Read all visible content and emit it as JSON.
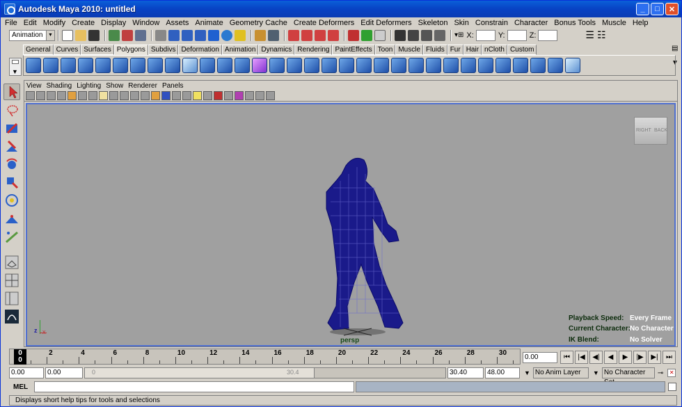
{
  "window": {
    "title": "Autodesk Maya 2010: untitled"
  },
  "menus": [
    "File",
    "Edit",
    "Modify",
    "Create",
    "Display",
    "Window",
    "Assets",
    "Animate",
    "Geometry Cache",
    "Create Deformers",
    "Edit Deformers",
    "Skeleton",
    "Skin",
    "Constrain",
    "Character",
    "Bonus Tools",
    "Muscle",
    "Help"
  ],
  "status": {
    "menuset": "Animation",
    "x_label": "X:",
    "y_label": "Y:",
    "z_label": "Z:"
  },
  "shelf": {
    "tabs": [
      "General",
      "Curves",
      "Surfaces",
      "Polygons",
      "Subdivs",
      "Deformation",
      "Animation",
      "Dynamics",
      "Rendering",
      "PaintEffects",
      "Toon",
      "Muscle",
      "Fluids",
      "Fur",
      "Hair",
      "nCloth",
      "Custom"
    ],
    "active_tab": "Polygons"
  },
  "viewport": {
    "menus": [
      "View",
      "Shading",
      "Lighting",
      "Show",
      "Renderer",
      "Panels"
    ],
    "camera": "persp",
    "viewcube_right": "RIGHT",
    "viewcube_back": "BACK",
    "axis_z": "z",
    "axis_x": "x",
    "hud": [
      {
        "label": "Playback Speed:",
        "value": "Every Frame"
      },
      {
        "label": "Current Character:",
        "value": "No Character"
      },
      {
        "label": "IK Blend:",
        "value": "No Solver"
      }
    ]
  },
  "timeline": {
    "ticks": [
      "2",
      "4",
      "6",
      "8",
      "10",
      "12",
      "14",
      "16",
      "18",
      "20",
      "22",
      "24",
      "26",
      "28",
      "30"
    ],
    "current_frame_top": "0",
    "current_frame_bottom": "0",
    "current_time": "0.00"
  },
  "range": {
    "start": "0.00",
    "anim_start": "0.00",
    "slider_left": "0",
    "slider_right": "30.4",
    "anim_end": "30.40",
    "end": "48.00",
    "anim_layer": "No Anim Layer",
    "character_set": "No Character Set"
  },
  "command": {
    "label": "MEL"
  },
  "help": {
    "text": "Displays short help tips for tools and selections"
  }
}
